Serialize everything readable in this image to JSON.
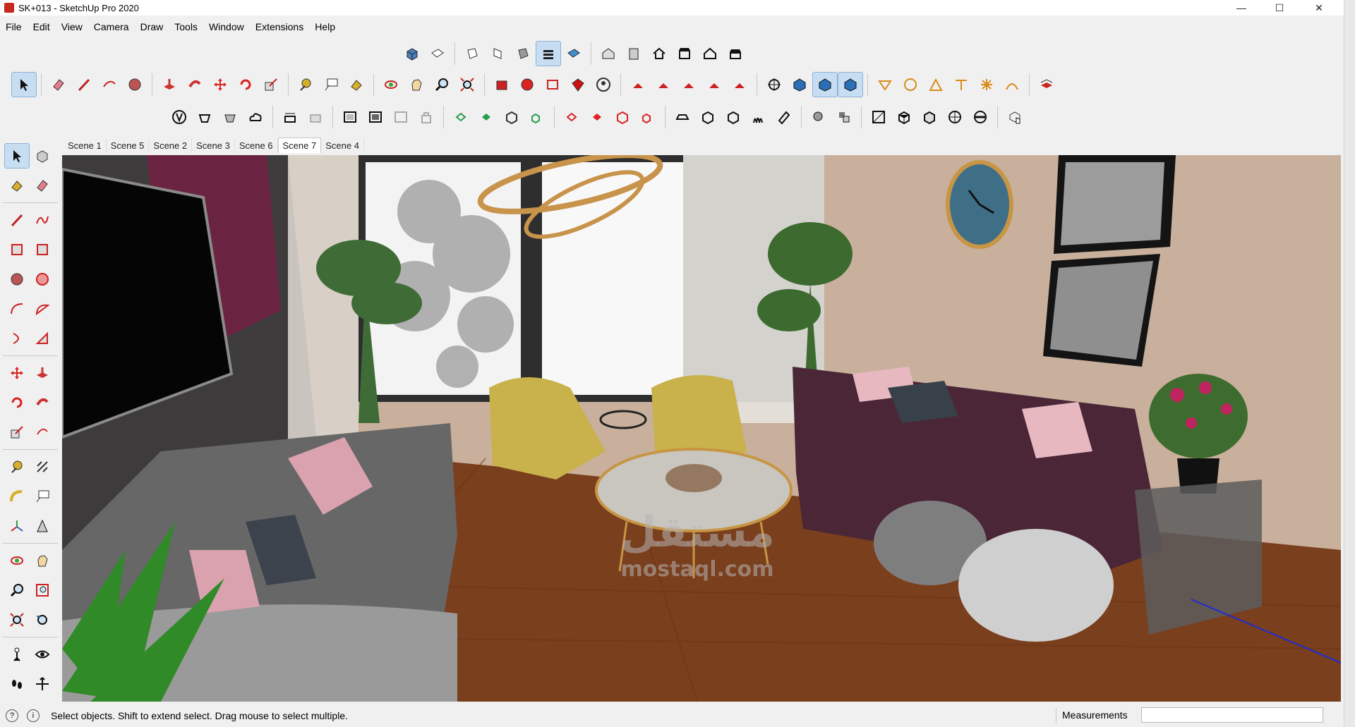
{
  "window": {
    "title": "SK+013 - SketchUp Pro 2020",
    "minimize": "—",
    "maximize": "☐",
    "close": "✕"
  },
  "menu": [
    "File",
    "Edit",
    "View",
    "Camera",
    "Draw",
    "Tools",
    "Window",
    "Extensions",
    "Help"
  ],
  "scene_tabs": {
    "items": [
      "Scene 1",
      "Scene 5",
      "Scene 2",
      "Scene 3",
      "Scene 6",
      "Scene 7",
      "Scene 4"
    ],
    "selected": "Scene 7"
  },
  "status": {
    "message": "Select objects. Shift to extend select. Drag mouse to select multiple.",
    "measurements_label": "Measurements",
    "measurements_value": ""
  },
  "watermark": {
    "arabic": "مستقل",
    "latin": "mostaql.com"
  },
  "icons": {
    "row1": [
      "iso-view-icon",
      "top-view-icon",
      "front-view-icon",
      "right-view-icon",
      "back-view-icon",
      "left-view-icon",
      "bottom-view-icon",
      "warehouse-icon",
      "components-icon",
      "home-icon",
      "building-icon",
      "house-icon",
      "roof-icon"
    ],
    "row2": [
      "select-icon",
      "eraser-icon",
      "line-icon",
      "arc-icon",
      "circle-icon",
      "pushpull-icon",
      "followme-icon",
      "move-icon",
      "rotate-icon",
      "scale-icon",
      "tape-icon",
      "text-icon",
      "paint-icon",
      "orbit-icon",
      "pan-icon",
      "zoom-icon",
      "zoom-extents-icon",
      "ruby-icon",
      "warehouse-3d-icon",
      "send-icon",
      "extension-icon",
      "profile-icon",
      "axes-icon"
    ],
    "row3": [
      "sandbox-icon",
      "shadow-icon",
      "fog-icon",
      "cloud-icon",
      "style-icon",
      "xray-icon",
      "hidden-icon",
      "shaded-icon",
      "textured-icon",
      "monochrome-icon",
      "lock-icon"
    ]
  },
  "colors": {
    "accent": "#2b6fb6",
    "viewport_wall": "#cbb39e",
    "floor": "#7a3e1c",
    "active_tool": "#c7ddf2"
  }
}
